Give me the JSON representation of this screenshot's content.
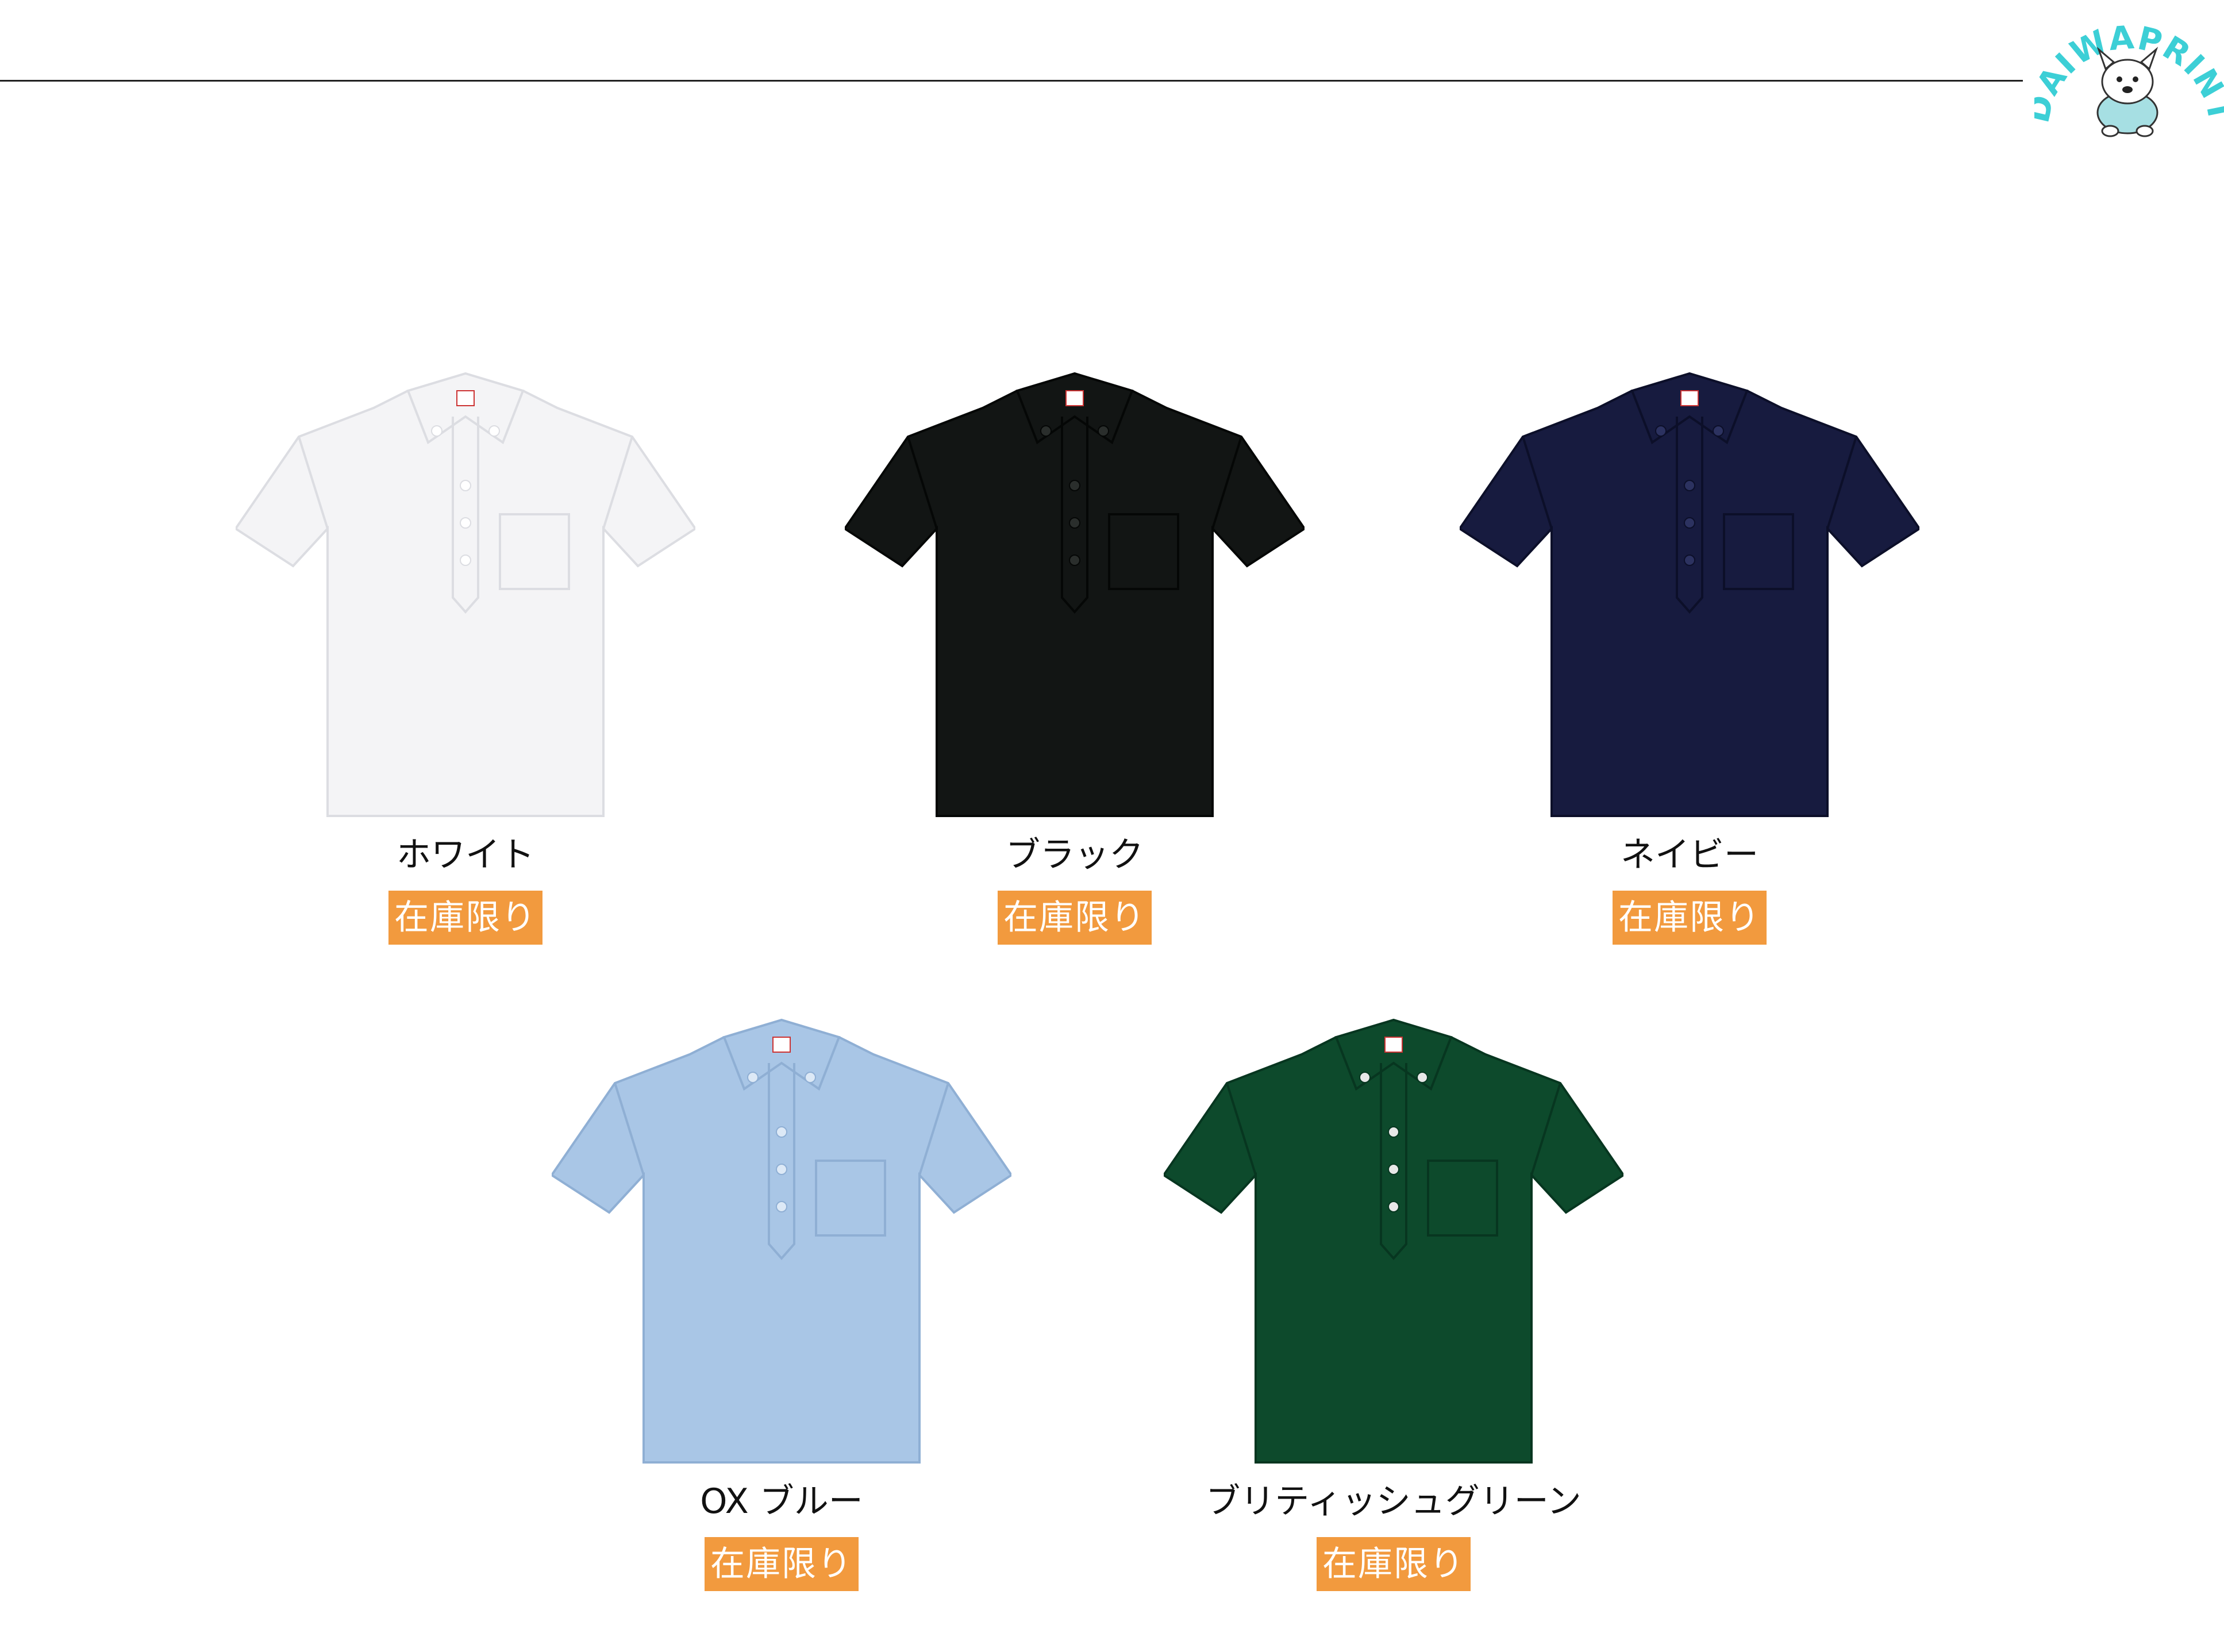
{
  "brand": {
    "logo_text": "DAIWAPRINT",
    "logo_color": "#3ccfd6"
  },
  "products": [
    {
      "name": "ホワイト",
      "badge": "在庫限り",
      "color": "#f4f4f6",
      "shadow": "#dcdde2",
      "button": "#ffffff"
    },
    {
      "name": "ブラック",
      "badge": "在庫限り",
      "color": "#121514",
      "shadow": "#050706",
      "button": "#2a2e2c"
    },
    {
      "name": "ネイビー",
      "badge": "在庫限り",
      "color": "#171b3f",
      "shadow": "#0c0f29",
      "button": "#2c3260"
    },
    {
      "name": "OX ブルー",
      "badge": "在庫限り",
      "color": "#a9c6e6",
      "shadow": "#8fafd4",
      "button": "#dde9f6"
    },
    {
      "name": "ブリティッシュグリーン",
      "badge": "在庫限り",
      "color": "#0d4a2c",
      "shadow": "#073620",
      "button": "#e8e8e8"
    }
  ],
  "badge_color": "#f29a3e"
}
